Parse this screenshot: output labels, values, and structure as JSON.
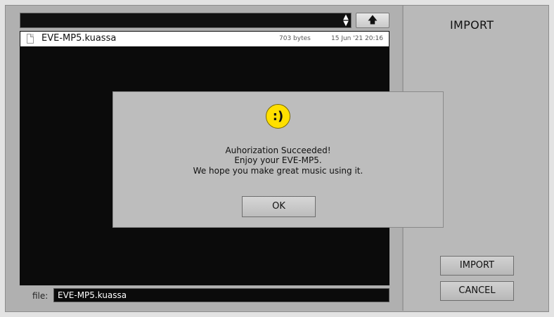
{
  "panel": {
    "title": "IMPORT"
  },
  "browser": {
    "folder_value": "",
    "files": [
      {
        "name": "EVE-MP5.kuassa",
        "size": "703 bytes",
        "date": "15 Jun '21 20:16"
      }
    ],
    "file_label": "file:",
    "file_value": "EVE-MP5.kuassa"
  },
  "buttons": {
    "import": "IMPORT",
    "cancel": "CANCEL"
  },
  "dialog": {
    "icon_text": ":)",
    "line1": "Auhorization Succeeded!",
    "line2": "Enjoy your EVE-MP5.",
    "line3": "We hope you make great music using it.",
    "ok": "OK"
  },
  "icons": {
    "up": "up-arrow-icon",
    "updown": "updown-icon",
    "file": "document-icon",
    "smiley": "smiley-icon"
  },
  "colors": {
    "accent_yellow": "#ffe000",
    "list_bg": "#0b0b0b"
  }
}
